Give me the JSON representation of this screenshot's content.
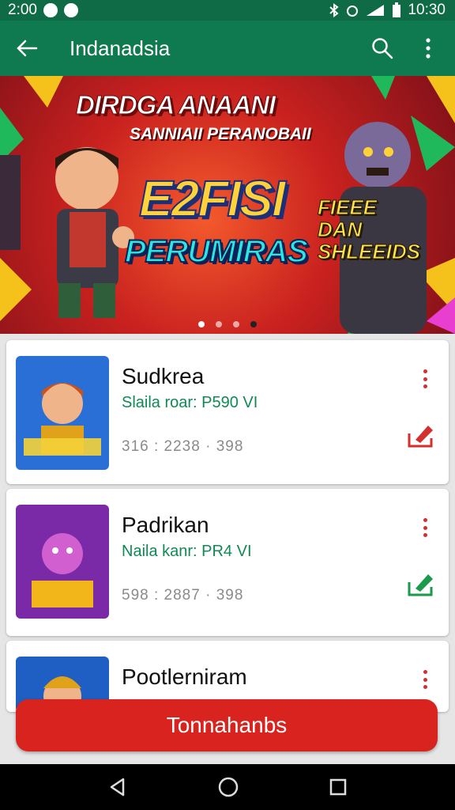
{
  "status": {
    "time_left": "2:00",
    "time_right": "10:30"
  },
  "app_bar": {
    "title": "Indanadsia"
  },
  "banner": {
    "headline": "DIRDGA ANAANI",
    "subheadline": "SANNIAII PERANOBAII",
    "big_title": "E2FISI",
    "big_title2": "PERUMIRAS",
    "side_text": "FIEEE DAN SHLEEIDS",
    "slides": 4,
    "active_slide": 1
  },
  "items": [
    {
      "title": "Sudkrea",
      "subtitle": "Slaila roar: P590 VI",
      "meta": "316 : 2238 · 398",
      "action_color": "#d32f2f"
    },
    {
      "title": "Padrikan",
      "subtitle": "Naila kanr: PR4 VI",
      "meta": "598 : 2887 · 398",
      "action_color": "#1a9a4a"
    },
    {
      "title": "Pootlerniram",
      "subtitle": "",
      "meta": "",
      "action_color": "#d32f2f"
    }
  ],
  "cta": {
    "label": "Tonnahanbs"
  },
  "colors": {
    "primary": "#0f7a4f",
    "accent": "#d9231e"
  }
}
